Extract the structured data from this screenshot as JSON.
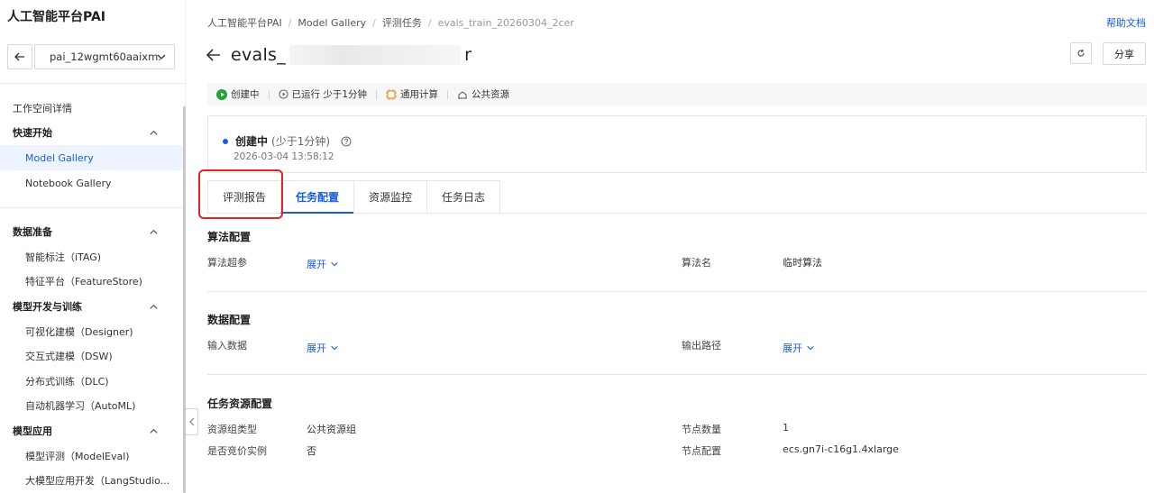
{
  "sidebar": {
    "brand": "人工智能平台PAI",
    "workspace": "pai_12wgmt60aaixm.",
    "workspace_details": "工作空间详情",
    "groups": [
      {
        "label": "快速开始",
        "items": [
          "Model Gallery",
          "Notebook Gallery"
        ]
      },
      {
        "label": "数据准备",
        "items": [
          "智能标注（iTAG)",
          "特征平台（FeatureStore)"
        ]
      },
      {
        "label": "模型开发与训练",
        "items": [
          "可视化建模（Designer)",
          "交互式建模（DSW)",
          "分布式训练（DLC)",
          "自动机器学习（AutoML)"
        ]
      },
      {
        "label": "模型应用",
        "items": [
          "模型评测（ModelEval)",
          "大模型应用开发（LangStudio..."
        ]
      }
    ],
    "active_item": "Model Gallery"
  },
  "breadcrumb": [
    "人工智能平台PAI",
    "Model Gallery",
    "评测任务",
    "evals_train_20260304_2cer"
  ],
  "help_link": "帮助文档",
  "title": {
    "prefix": "evals_",
    "suffix": "r"
  },
  "share_label": "分享",
  "status_strip": [
    {
      "icon": "play-circle-icon",
      "label": "创建中"
    },
    {
      "icon": "clock-run-icon",
      "label": "已运行 少于1分钟"
    },
    {
      "icon": "compute-icon",
      "label": "通用计算"
    },
    {
      "icon": "public-resource-icon",
      "label": "公共资源"
    }
  ],
  "status_card": {
    "status": "创建中",
    "duration": "(少于1分钟)",
    "time": "2026-03-04 13:58:12"
  },
  "tabs": [
    "评测报告",
    "任务配置",
    "资源监控",
    "任务日志"
  ],
  "active_tab": "任务配置",
  "sections": {
    "algorithm": {
      "title": "算法配置",
      "hyperparams_label": "算法超参",
      "expand": "展开",
      "algo_name_label": "算法名",
      "algo_name_value": "临时算法"
    },
    "data": {
      "title": "数据配置",
      "input_label": "输入数据",
      "expand": "展开",
      "output_label": "输出路径"
    },
    "resource": {
      "title": "任务资源配置",
      "group_type_label": "资源组类型",
      "group_type_value": "公共资源组",
      "node_count_label": "节点数量",
      "node_count_value": "1",
      "spot_label": "是否竞价实例",
      "spot_value": "否",
      "node_spec_label": "节点配置",
      "node_spec_value": "ecs.gn7i-c16g1.4xlarge"
    }
  },
  "colors": {
    "accent": "#1a5cde",
    "highlight": "#e02424",
    "status_green": "#22a33a"
  }
}
